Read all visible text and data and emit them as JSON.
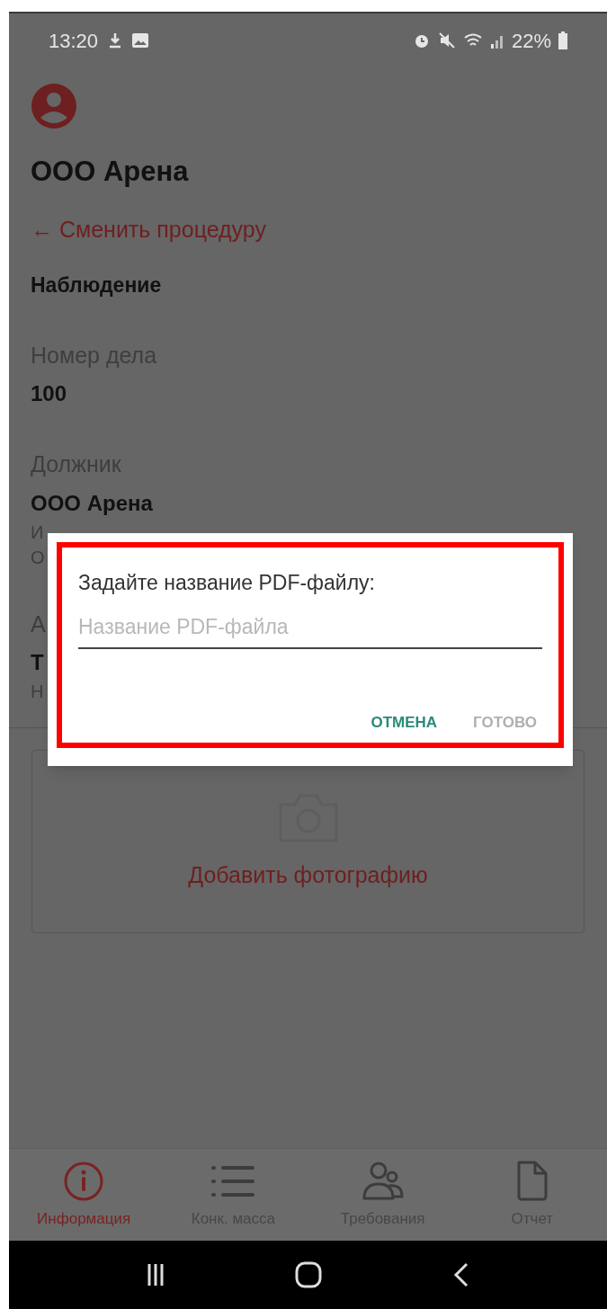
{
  "status_bar": {
    "time": "13:20",
    "battery": "22%"
  },
  "header": {
    "title": "ООО Арена",
    "back_link": "← Сменить процедуру",
    "procedure": "Наблюдение"
  },
  "fields": [
    {
      "label": "Номер дела",
      "value": "100"
    },
    {
      "label": "Должник",
      "value": "ООО Арена",
      "details": [
        "И",
        "О"
      ]
    },
    {
      "label": "А",
      "value": "Т",
      "details": [
        "Н"
      ]
    }
  ],
  "photo": {
    "label": "Добавить фотографию"
  },
  "dialog": {
    "title": "Задайте название PDF-файлу:",
    "placeholder": "Название PDF-файла",
    "buttons": [
      {
        "label": "ОТМЕНА",
        "disabled": false
      },
      {
        "label": "ГОТОВО",
        "disabled": true
      }
    ]
  },
  "nav": [
    {
      "kind": "info",
      "label": "Информация",
      "selected": true
    },
    {
      "kind": "list",
      "label": "Конк. масса",
      "selected": false
    },
    {
      "kind": "people",
      "label": "Требования",
      "selected": false
    },
    {
      "kind": "file",
      "label": "Отчет",
      "selected": false
    }
  ]
}
